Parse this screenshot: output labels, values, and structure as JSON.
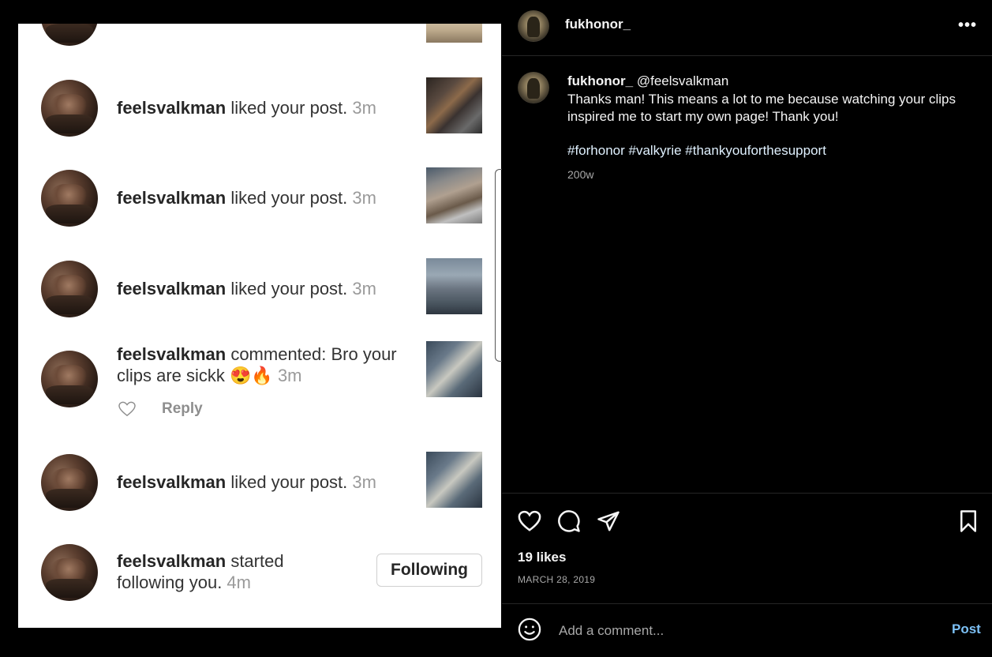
{
  "left_media": {
    "notifications": [
      {
        "user": "feelsvalkman",
        "action": " liked your post. ",
        "time": "3m"
      },
      {
        "user": "feelsvalkman",
        "action": " liked your post. ",
        "time": "3m"
      },
      {
        "user": "feelsvalkman",
        "action": " liked your post. ",
        "time": "3m"
      },
      {
        "user": "feelsvalkman",
        "action": " commented: Bro your clips are sickk 😍🔥 ",
        "time": "3m"
      },
      {
        "user": "feelsvalkman",
        "action": " liked your post. ",
        "time": "3m"
      },
      {
        "user": "feelsvalkman",
        "action": " started following you. ",
        "time": "4m"
      }
    ],
    "reply_label": "Reply",
    "following_label": "Following"
  },
  "post": {
    "author": "fukhonor_",
    "comment": {
      "user": "fukhonor_",
      "mention": "@feelsvalkman",
      "text": "Thanks man! This means a lot to me because watching your clips inspired me to start my own page! Thank you!",
      "hashtags": "#forhonor #valkyrie #thankyouforthesupport",
      "age": "200w"
    },
    "likes": "19 likes",
    "date": "MARCH 28, 2019",
    "comment_placeholder": "Add a comment...",
    "post_label": "Post",
    "more_label": "•••"
  }
}
